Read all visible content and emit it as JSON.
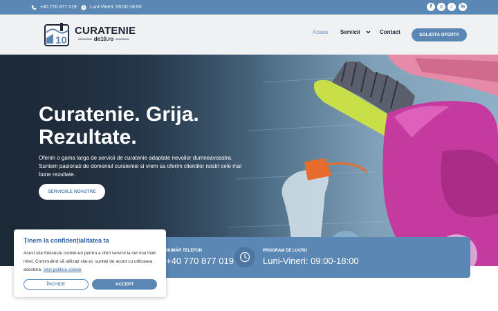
{
  "topbar": {
    "phone": "+40 770 877 019",
    "hours": "Luni-Vineri: 09:00-18:00",
    "social": [
      "facebook-icon",
      "instagram-icon",
      "tiktok-icon",
      "linkedin-icon"
    ]
  },
  "header": {
    "logo_title": "CURATENIE",
    "logo_sub": "de10.ro",
    "logo_badge": "10",
    "nav": [
      {
        "label": "Acasa",
        "active": true
      },
      {
        "label": "Servicii"
      },
      {
        "label": "Contact"
      }
    ],
    "cta": "SOLICITA OFERTA"
  },
  "hero": {
    "title_line1": "Curatenie. Grija.",
    "title_line2": "Rezultate.",
    "description": "Oferim o gama larga de servicii de curatenie adaptate nevoilor dumneavoastra. Suntem pasionati de domeniul curateniei si vrem sa oferim clientilor nostri cele mai bune rezultate.",
    "button": "SERVICIILE NOASTRE"
  },
  "info": {
    "phone_label": "NUMĂR TELEFON",
    "phone_value": "+40 770 877 019",
    "hours_label": "PROGRAM DE LUCRU",
    "hours_value": "Luni-Vineri: 09:00-18:00"
  },
  "cookie": {
    "title": "Ținem la confidențialitatea ta",
    "text": "Acest site folosește cookie-uri pentru a oferi servicii la cel mai înalt nivel. Continuând să utilizați site-ul, sunteți de acord cu utilizarea acestora.",
    "link": "Vezi politica cookie",
    "close": "ÎNCHIDE",
    "accept": "ACCEPT"
  },
  "colors": {
    "primary": "#5a87b4",
    "dark_text": "#1d2533",
    "header_bg": "#f0f1f3",
    "link_blue": "#2c5fa0"
  }
}
